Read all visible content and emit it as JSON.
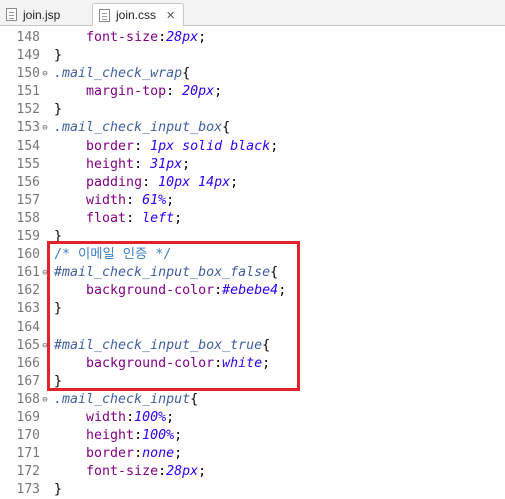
{
  "tabs": [
    {
      "label": "join.jsp",
      "active": false,
      "icon": "jsp-file-icon"
    },
    {
      "label": "join.css",
      "active": true,
      "icon": "css-file-icon",
      "close": "✕"
    }
  ],
  "lines": [
    {
      "n": "148",
      "fold": false,
      "tokens": [
        [
          "i",
          "    "
        ],
        [
          "p",
          "font-size"
        ],
        [
          "t",
          ":"
        ],
        [
          "v",
          "28px"
        ],
        [
          "t",
          ";"
        ]
      ]
    },
    {
      "n": "149",
      "fold": false,
      "tokens": [
        [
          "t",
          "}"
        ]
      ]
    },
    {
      "n": "150",
      "fold": true,
      "tokens": [
        [
          "s",
          ".mail_check_wrap"
        ],
        [
          "t",
          "{"
        ]
      ]
    },
    {
      "n": "151",
      "fold": false,
      "tokens": [
        [
          "i",
          "    "
        ],
        [
          "p",
          "margin-top"
        ],
        [
          "t",
          ": "
        ],
        [
          "v",
          "20px"
        ],
        [
          "t",
          ";"
        ]
      ]
    },
    {
      "n": "152",
      "fold": false,
      "tokens": [
        [
          "t",
          "}"
        ]
      ]
    },
    {
      "n": "153",
      "fold": true,
      "tokens": [
        [
          "s",
          ".mail_check_input_box"
        ],
        [
          "t",
          "{"
        ]
      ]
    },
    {
      "n": "154",
      "fold": false,
      "tokens": [
        [
          "i",
          "    "
        ],
        [
          "p",
          "border"
        ],
        [
          "t",
          ": "
        ],
        [
          "v",
          "1px solid black"
        ],
        [
          "t",
          ";"
        ]
      ]
    },
    {
      "n": "155",
      "fold": false,
      "tokens": [
        [
          "i",
          "    "
        ],
        [
          "p",
          "height"
        ],
        [
          "t",
          ": "
        ],
        [
          "v",
          "31px"
        ],
        [
          "t",
          ";"
        ]
      ]
    },
    {
      "n": "156",
      "fold": false,
      "tokens": [
        [
          "i",
          "    "
        ],
        [
          "p",
          "padding"
        ],
        [
          "t",
          ": "
        ],
        [
          "v",
          "10px 14px"
        ],
        [
          "t",
          ";"
        ]
      ]
    },
    {
      "n": "157",
      "fold": false,
      "tokens": [
        [
          "i",
          "    "
        ],
        [
          "p",
          "width"
        ],
        [
          "t",
          ": "
        ],
        [
          "v",
          "61%"
        ],
        [
          "t",
          ";"
        ]
      ]
    },
    {
      "n": "158",
      "fold": false,
      "tokens": [
        [
          "i",
          "    "
        ],
        [
          "p",
          "float"
        ],
        [
          "t",
          ": "
        ],
        [
          "v",
          "left"
        ],
        [
          "t",
          ";"
        ]
      ]
    },
    {
      "n": "159",
      "fold": false,
      "tokens": [
        [
          "t",
          "}"
        ]
      ]
    },
    {
      "n": "160",
      "fold": false,
      "tokens": [
        [
          "c",
          "/* 이메일 인증 */"
        ]
      ]
    },
    {
      "n": "161",
      "fold": true,
      "tokens": [
        [
          "s",
          "#mail_check_input_box_false"
        ],
        [
          "t",
          "{"
        ]
      ]
    },
    {
      "n": "162",
      "fold": false,
      "tokens": [
        [
          "i",
          "    "
        ],
        [
          "p",
          "background-color"
        ],
        [
          "t",
          ":"
        ],
        [
          "v",
          "#ebebe4"
        ],
        [
          "t",
          ";"
        ]
      ]
    },
    {
      "n": "163",
      "fold": false,
      "tokens": [
        [
          "t",
          "}"
        ]
      ]
    },
    {
      "n": "164",
      "fold": false,
      "tokens": []
    },
    {
      "n": "165",
      "fold": true,
      "tokens": [
        [
          "s",
          "#mail_check_input_box_true"
        ],
        [
          "t",
          "{"
        ]
      ]
    },
    {
      "n": "166",
      "fold": false,
      "tokens": [
        [
          "i",
          "    "
        ],
        [
          "p",
          "background-color"
        ],
        [
          "t",
          ":"
        ],
        [
          "v",
          "white"
        ],
        [
          "t",
          ";"
        ]
      ]
    },
    {
      "n": "167",
      "fold": false,
      "tokens": [
        [
          "t",
          "}"
        ]
      ]
    },
    {
      "n": "168",
      "fold": true,
      "tokens": [
        [
          "s",
          ".mail_check_input"
        ],
        [
          "t",
          "{"
        ]
      ]
    },
    {
      "n": "169",
      "fold": false,
      "tokens": [
        [
          "i",
          "    "
        ],
        [
          "p",
          "width"
        ],
        [
          "t",
          ":"
        ],
        [
          "v",
          "100%"
        ],
        [
          "t",
          ";"
        ]
      ]
    },
    {
      "n": "170",
      "fold": false,
      "tokens": [
        [
          "i",
          "    "
        ],
        [
          "p",
          "height"
        ],
        [
          "t",
          ":"
        ],
        [
          "v",
          "100%"
        ],
        [
          "t",
          ";"
        ]
      ]
    },
    {
      "n": "171",
      "fold": false,
      "tokens": [
        [
          "i",
          "    "
        ],
        [
          "p",
          "border"
        ],
        [
          "t",
          ":"
        ],
        [
          "v",
          "none"
        ],
        [
          "t",
          ";"
        ]
      ]
    },
    {
      "n": "172",
      "fold": false,
      "tokens": [
        [
          "i",
          "    "
        ],
        [
          "p",
          "font-size"
        ],
        [
          "t",
          ":"
        ],
        [
          "v",
          "28px"
        ],
        [
          "t",
          ";"
        ]
      ]
    },
    {
      "n": "173",
      "fold": false,
      "tokens": [
        [
          "t",
          "}"
        ]
      ]
    }
  ],
  "fold_glyph": "⊖",
  "colors": {
    "property": "#7f007f",
    "selector": "#3f5f9f",
    "value": "#2a00ff",
    "comment": "#3f7fbf",
    "highlight_box": "#e4222a"
  }
}
